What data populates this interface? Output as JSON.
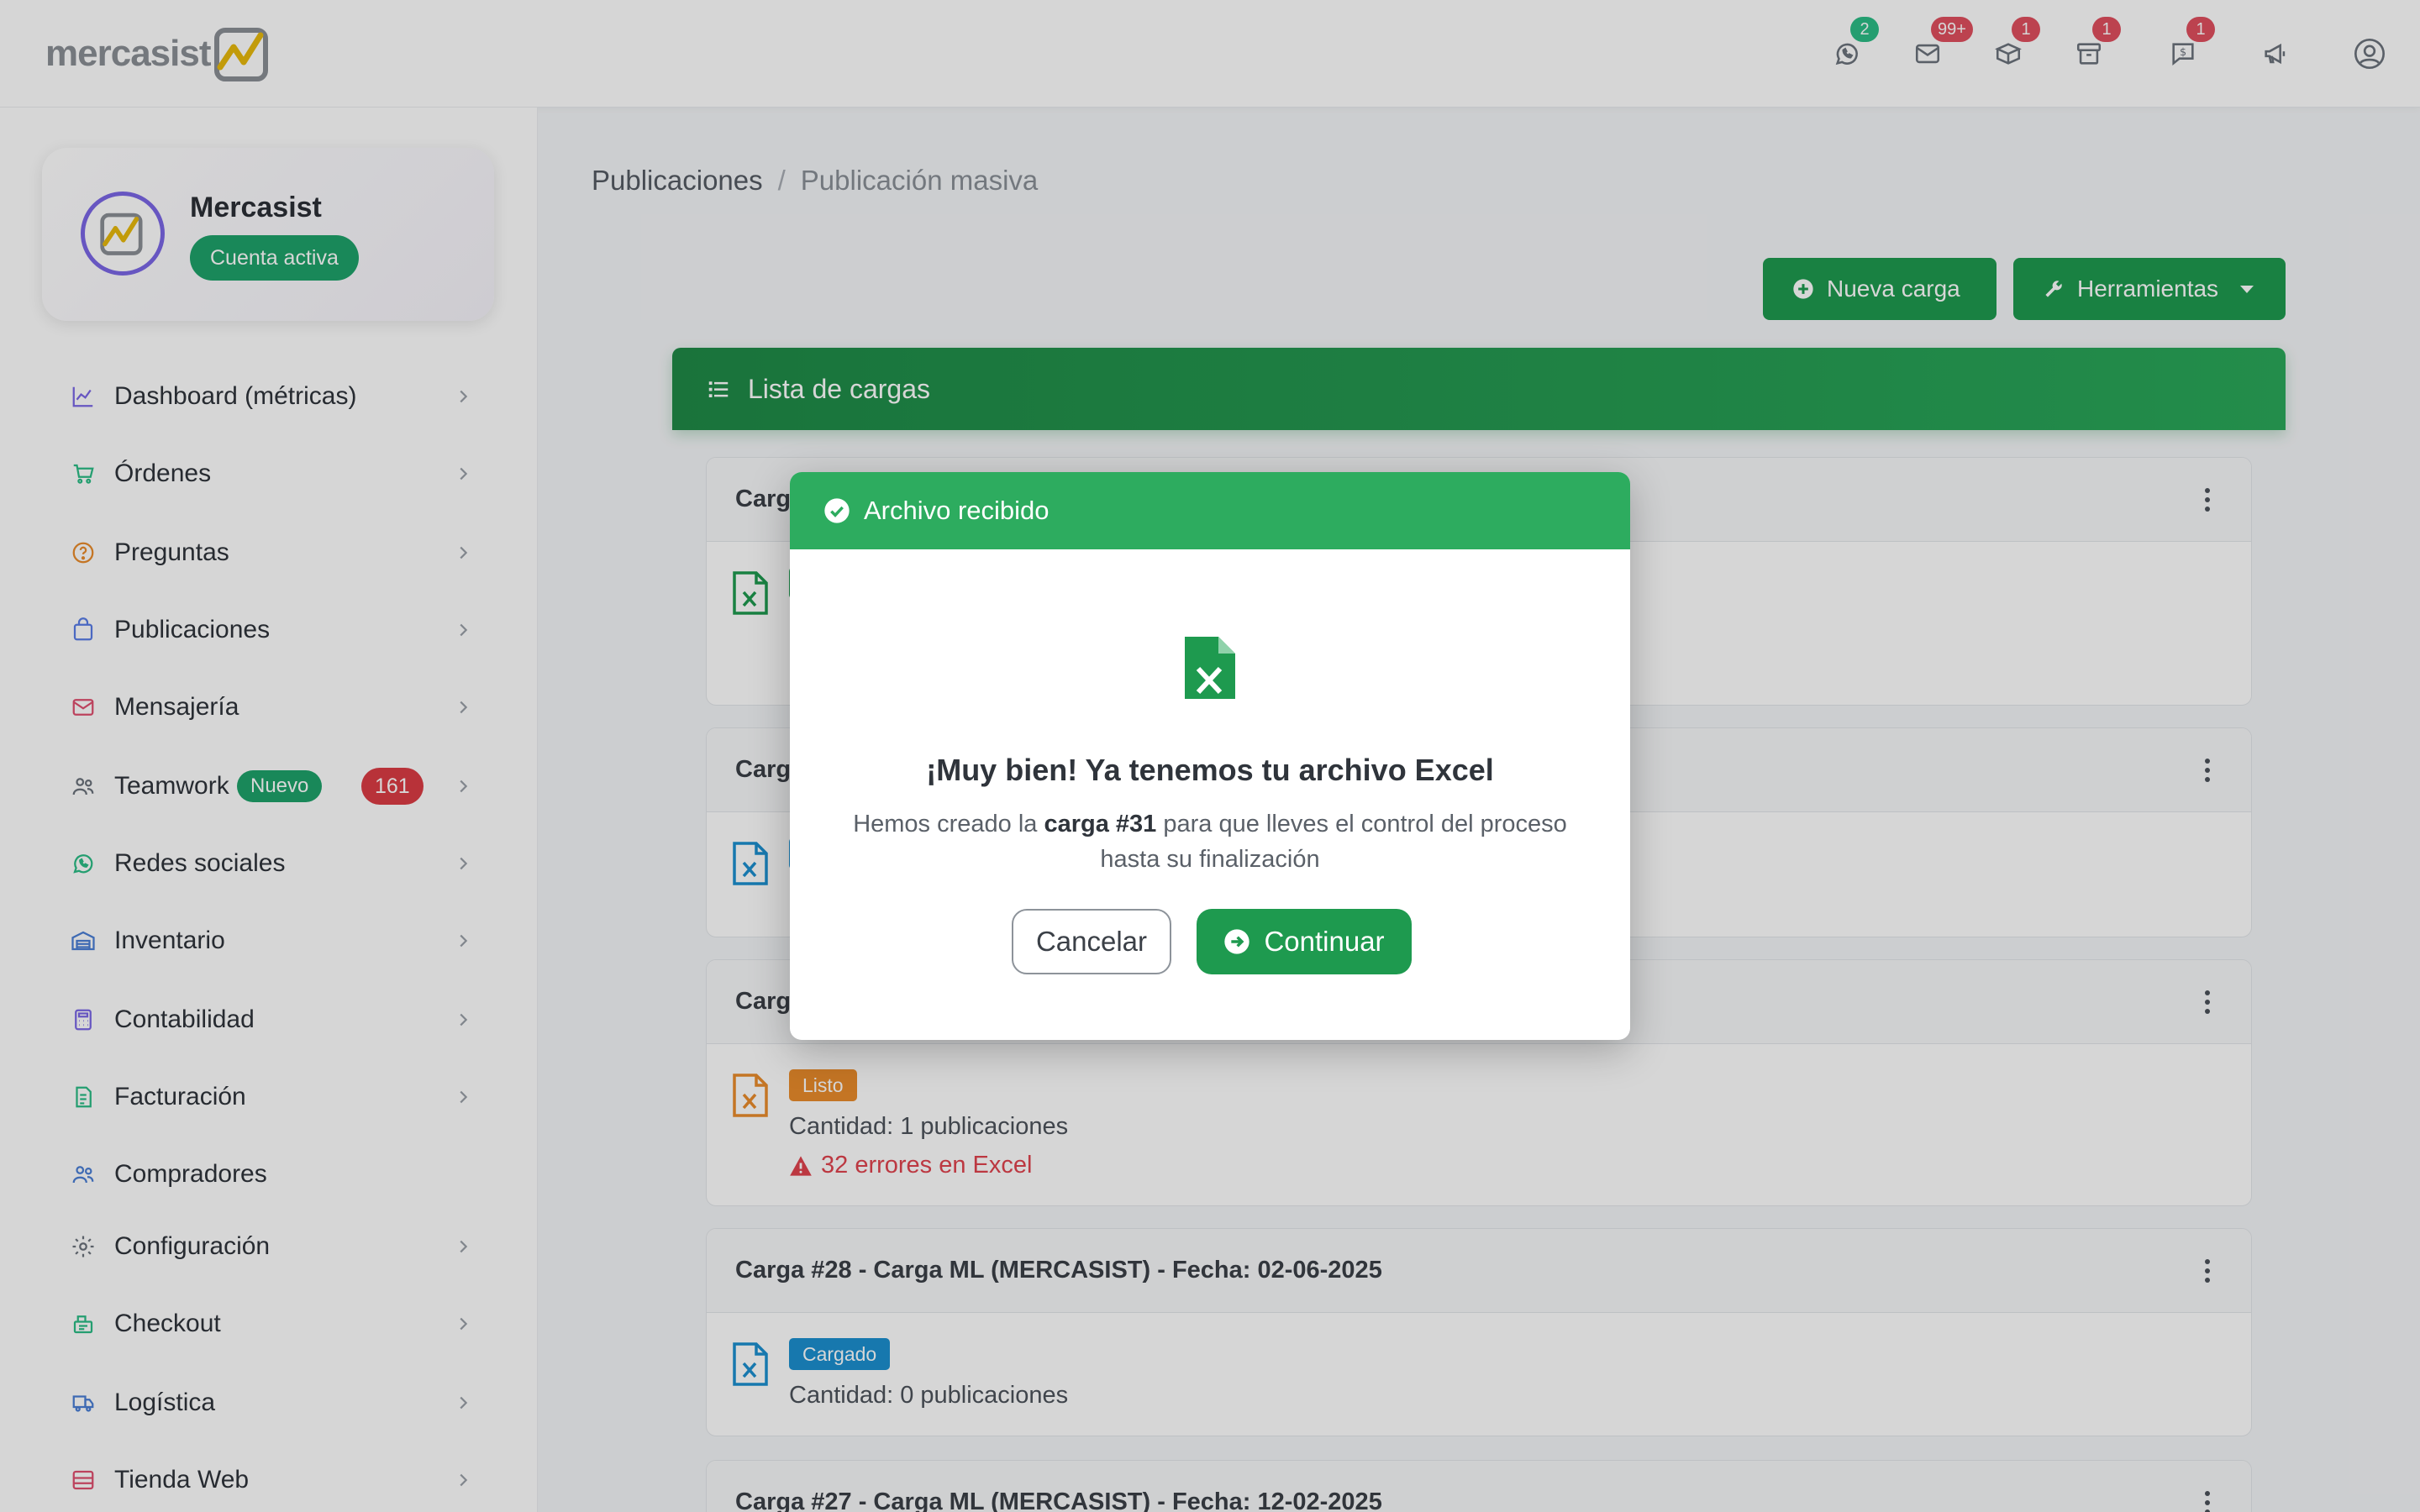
{
  "brand": {
    "name": "mercasist"
  },
  "topbar": {
    "icons": [
      {
        "name": "whatsapp-icon",
        "badge": "2",
        "badge_color": "#2bbd86"
      },
      {
        "name": "mail-icon",
        "badge": "99+",
        "badge_color": "#e04f5f"
      },
      {
        "name": "box-icon",
        "badge": "1",
        "badge_color": "#e04f5f"
      },
      {
        "name": "archive-icon",
        "badge": "1",
        "badge_color": "#e04f5f"
      },
      {
        "name": "dollar-chat-icon",
        "badge": "1",
        "badge_color": "#e04f5f"
      },
      {
        "name": "megaphone-icon",
        "badge": ""
      },
      {
        "name": "user-circle-icon",
        "badge": ""
      }
    ]
  },
  "profile": {
    "name": "Mercasist",
    "status": "Cuenta activa"
  },
  "sidebar": {
    "items": [
      {
        "label": "Dashboard (métricas)",
        "icon": "chart-icon"
      },
      {
        "label": "Órdenes",
        "icon": "cart-icon"
      },
      {
        "label": "Preguntas",
        "icon": "question-icon"
      },
      {
        "label": "Publicaciones",
        "icon": "bag-icon"
      },
      {
        "label": "Mensajería",
        "icon": "mail-icon"
      },
      {
        "label": "Teamwork",
        "icon": "team-icon",
        "pill": "Nuevo",
        "count": "161"
      },
      {
        "label": "Redes sociales",
        "icon": "whatsapp-icon"
      },
      {
        "label": "Inventario",
        "icon": "warehouse-icon"
      },
      {
        "label": "Contabilidad",
        "icon": "calculator-icon"
      },
      {
        "label": "Facturación",
        "icon": "invoice-icon"
      },
      {
        "label": "Compradores",
        "icon": "buyers-icon"
      },
      {
        "label": "Configuración",
        "icon": "gear-icon"
      },
      {
        "label": "Checkout",
        "icon": "checkout-icon"
      },
      {
        "label": "Logística",
        "icon": "truck-icon"
      },
      {
        "label": "Tienda Web",
        "icon": "store-icon"
      }
    ]
  },
  "breadcrumb": {
    "parent": "Publicaciones",
    "separator": "/",
    "current": "Publicación masiva"
  },
  "toolbar": {
    "new_label": "Nueva carga",
    "tools_label": "Herramientas"
  },
  "list": {
    "title": "Lista de cargas",
    "cards": [
      {
        "title": "Carga",
        "status": "",
        "qty": "",
        "error": ""
      },
      {
        "title": "Carga",
        "status": "",
        "qty": "",
        "error": ""
      },
      {
        "title": "Carga",
        "status": "Listo",
        "qty": "Cantidad: 1 publicaciones",
        "error": "32 errores en Excel"
      },
      {
        "title": "Carga #28 - Carga ML (MERCASIST) - Fecha: 02-06-2025",
        "status": "Cargado",
        "qty": "Cantidad: 0 publicaciones",
        "error": ""
      },
      {
        "title": "Carga #27 - Carga ML (MERCASIST) - Fecha: 12-02-2025",
        "status": "",
        "qty": "",
        "error": ""
      }
    ]
  },
  "modal": {
    "title": "Archivo recibido",
    "heading": "¡Muy bien! Ya tenemos tu archivo Excel",
    "text_before": "Hemos creado la",
    "text_bold": "carga #31",
    "text_after": "para que lleves el control del proceso hasta su finalización",
    "cancel_label": "Cancelar",
    "continue_label": "Continuar"
  },
  "colors": {
    "accent": "#1e9a4f",
    "header_green": "#2dac5f",
    "danger": "#dc3c45",
    "info": "#1c8fd0",
    "warning": "#ea8c2c"
  }
}
